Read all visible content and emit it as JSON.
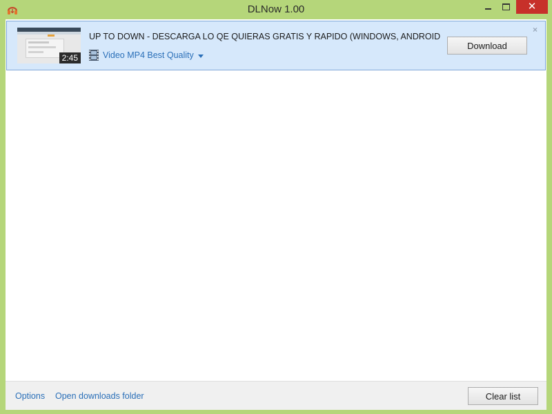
{
  "window": {
    "title": "DLNow 1.00",
    "app_icon": "headphones-icon",
    "close_glyph": "✕",
    "frame_color": "#b5d67a",
    "close_color": "#c7302a"
  },
  "download_item": {
    "title": "UP TO DOWN - DESCARGA LO QE QUIERAS GRATIS Y RAPIDO (WINDOWS, ANDROID, IOS,...",
    "duration": "2:45",
    "format": "Video MP4 Best Quality",
    "format_icon": "film-icon",
    "download_label": "Download",
    "dismiss_glyph": "×",
    "highlight_color": "#d6e8fb"
  },
  "footer": {
    "options_label": "Options",
    "open_folder_label": "Open downloads folder",
    "clear_label": "Clear list",
    "link_color": "#2a6fb8"
  }
}
